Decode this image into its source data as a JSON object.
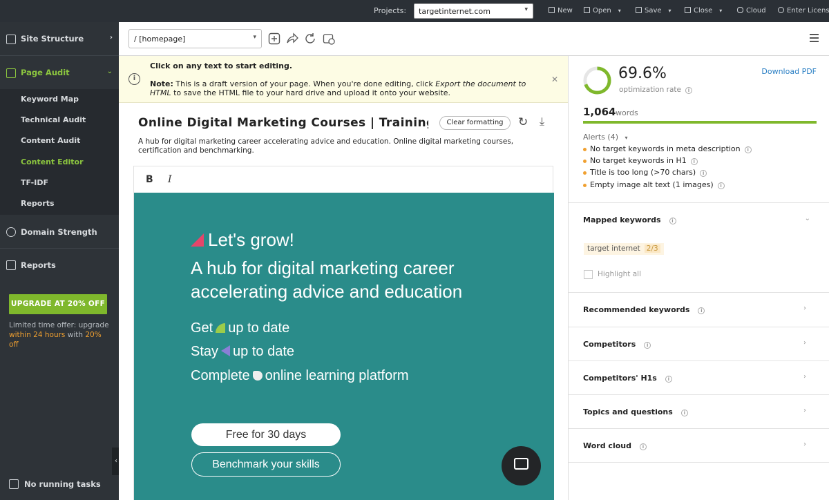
{
  "topbar": {
    "projects_label": "Projects:",
    "project_value": "targetinternet.com",
    "items": [
      {
        "label": "New",
        "icon": "new-doc-icon"
      },
      {
        "label": "Open",
        "icon": "folder-icon"
      },
      {
        "label": "Save",
        "icon": "save-icon"
      },
      {
        "label": "Close",
        "icon": "close-square-icon"
      },
      {
        "label": "Cloud",
        "icon": "cloud-icon"
      },
      {
        "label": "Enter License",
        "icon": "key-icon"
      }
    ]
  },
  "sidebar": {
    "site_structure": "Site Structure",
    "page_audit": "Page Audit",
    "sub_items": [
      "Keyword Map",
      "Technical Audit",
      "Content Audit",
      "Content Editor",
      "TF-IDF",
      "Reports"
    ],
    "active_sub": "Content Editor",
    "domain_strength": "Domain Strength",
    "reports": "Reports",
    "upgrade_button": "UPGRADE AT 20% OFF",
    "offer_part1": "Limited time offer: upgrade",
    "offer_highlight1": "within 24 hours",
    "offer_part2": " with ",
    "offer_highlight2": "20% off",
    "tasks": "No running tasks",
    "accent_color": "#7fb82c"
  },
  "urlbar": {
    "url_value": "/ [homepage]"
  },
  "notice": {
    "title": "Click on any text to start editing.",
    "note_label": "Note:",
    "note_text1": " This is a draft version of your page. When you're done editing, click ",
    "note_italic": "Export the document to HTML",
    "note_text2": " to save the HTML file to your hard drive and upload it onto your website."
  },
  "document": {
    "title": "Online Digital Marketing Courses | Training | Certification",
    "clear_formatting": "Clear formatting",
    "meta_description": "A hub for digital marketing career accelerating advice and education. Online digital marketing courses, certification and benchmarking."
  },
  "editor": {
    "bold_label": "B",
    "italic_label": "I"
  },
  "hero": {
    "tagline": "Let's grow!",
    "headline": "A hub for digital marketing career accelerating advice and education",
    "line1_a": "Get",
    "line1_b": "up to date",
    "line2_a": "Stay",
    "line2_b": "up to date",
    "line3_a": "Complete",
    "line3_b": "online learning platform",
    "cta_primary": "Free for 30 days",
    "cta_secondary": "Benchmark your skills",
    "bg_color": "#2a8c8a"
  },
  "panel": {
    "optimization_rate": "69.6%",
    "optimization_rate_value": 69.6,
    "optimization_label": "optimization rate",
    "download_pdf": "Download PDF",
    "words_count": "1,064",
    "words_label": "words",
    "alerts_header": "Alerts (4)",
    "alerts": [
      "No target keywords in meta description",
      "No target keywords in H1",
      "Title is too long (>70 chars)",
      "Empty image alt text (1 images)"
    ],
    "mapped_keywords": "Mapped keywords",
    "keyword_chip": "target internet",
    "keyword_count": "2/3",
    "highlight_all": "Highlight all",
    "sections": [
      "Recommended keywords",
      "Competitors",
      "Competitors' H1s",
      "Topics and questions",
      "Word cloud"
    ]
  }
}
